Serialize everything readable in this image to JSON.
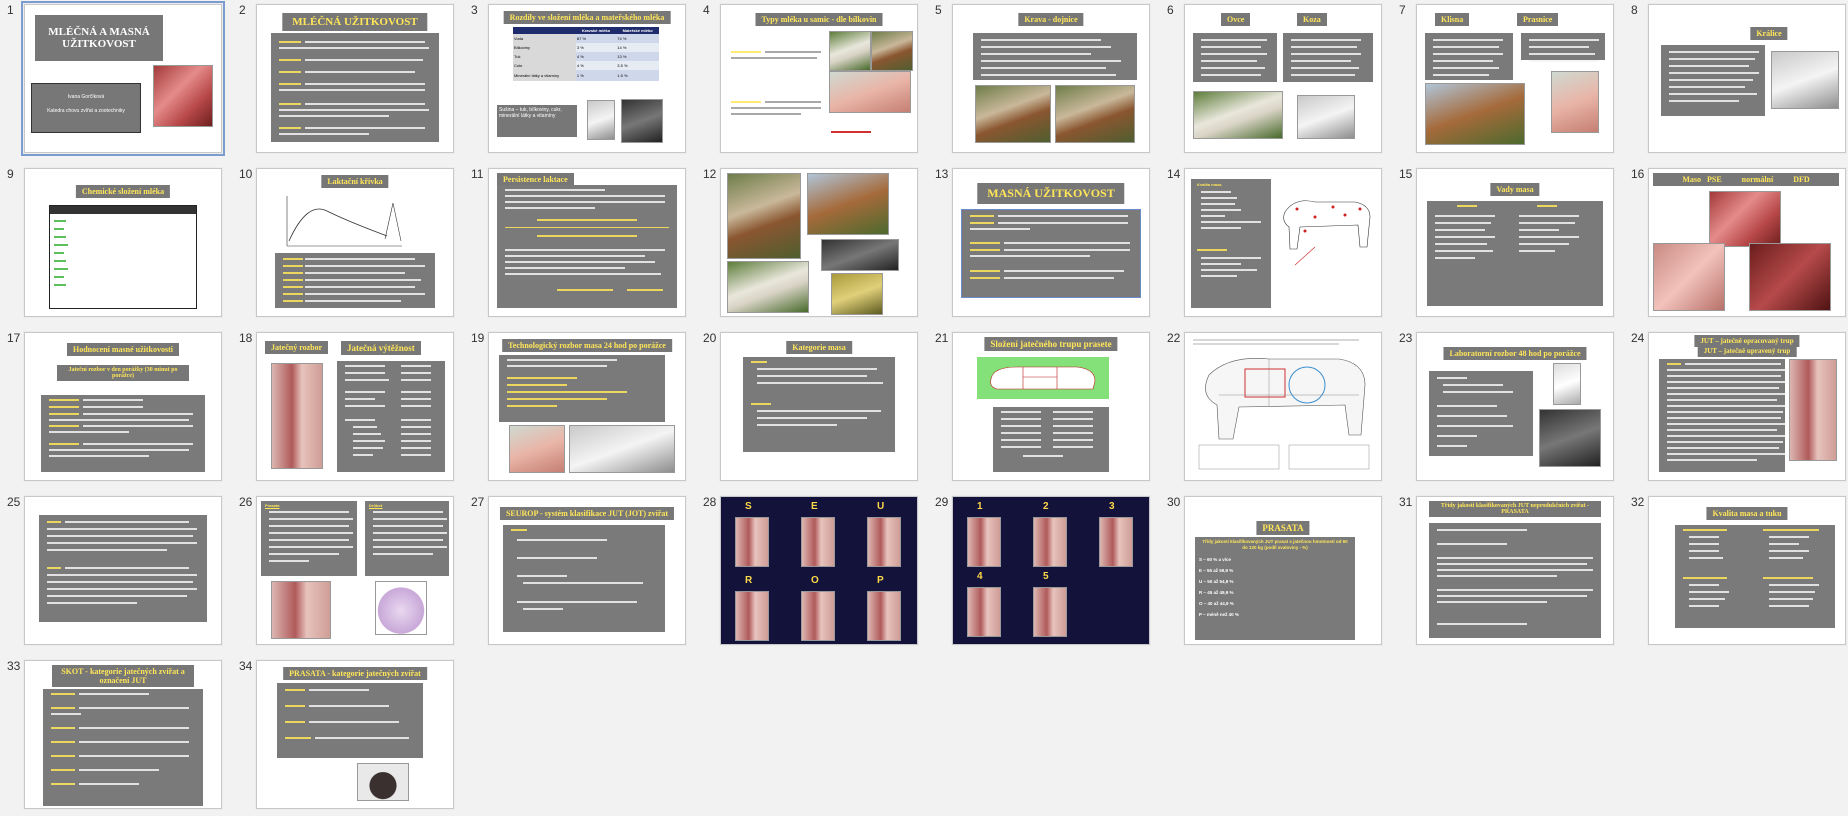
{
  "slides": [
    {
      "n": "1",
      "title": "MLÉČNÁ A MASNÁ UŽITKOVOST",
      "author": "Ivana Gorčíková",
      "dept": "Katedra chovu zvířat a zootechniky"
    },
    {
      "n": "2",
      "title": "MLÉČNÁ UŽITKOVOST"
    },
    {
      "n": "3",
      "title": "Rozdíly ve složení mléka a mateřského mléka",
      "table_header": [
        "",
        "Kravské mléko",
        "Mateřské mléko"
      ],
      "table_rows": [
        [
          "Voda",
          "87 %",
          "74 %"
        ],
        [
          "Bílkoviny",
          "3 %",
          "14 %"
        ],
        [
          "Tuk",
          "4 %",
          "13 %"
        ],
        [
          "Cukr",
          "4 %",
          "3.5 %"
        ],
        [
          "Minerální látky a vitamíny",
          "1 %",
          "1.5 %"
        ]
      ],
      "note": "Sušina – tuk, bílkoviny, cukr, minerální látky a vitamíny"
    },
    {
      "n": "4",
      "title": "Typy mléka u samic - dle bílkovin"
    },
    {
      "n": "5",
      "title": "Krava - dojnice"
    },
    {
      "n": "6",
      "title": "Ovce",
      "title2": "Koza"
    },
    {
      "n": "7",
      "title": "Klisna",
      "title2": "Prasnice"
    },
    {
      "n": "8",
      "title": "Králice"
    },
    {
      "n": "9",
      "title": "Chemické složení mléka"
    },
    {
      "n": "10",
      "title": "Laktační křivka"
    },
    {
      "n": "11",
      "title": "Persistence laktace"
    },
    {
      "n": "12",
      "title": ""
    },
    {
      "n": "13",
      "title": "MASNÁ UŽITKOVOST"
    },
    {
      "n": "14",
      "title": "Kvalita masa"
    },
    {
      "n": "15",
      "title": "Vady masa"
    },
    {
      "n": "16",
      "title": "Maso   PSE          normální          DFD"
    },
    {
      "n": "17",
      "title": "Hodnocení masné užitkovosti",
      "subtitle": "Jateční rozbor v den porážky (30 minut po porážce)"
    },
    {
      "n": "18",
      "title": "Jatečný rozbor",
      "title2": "Jatečná výtěžnost"
    },
    {
      "n": "19",
      "title": "Technologický rozbor masa 24 hod po porážce"
    },
    {
      "n": "20",
      "title": "Kategorie masa"
    },
    {
      "n": "21",
      "title": "Složení jatečného trupu prasete"
    },
    {
      "n": "22",
      "title": ""
    },
    {
      "n": "23",
      "title": "Laboratorní rozbor 48 hod po porážce"
    },
    {
      "n": "24",
      "title": "JUT – jatečně opracovaný trup",
      "title2": "JUT – jatečně upravený trup"
    },
    {
      "n": "25",
      "title": ""
    },
    {
      "n": "26",
      "title": "Prasata",
      "title2": "Drůbež"
    },
    {
      "n": "27",
      "title": "SEUROP - systém klasifikace JUT (JOT) zvířat"
    },
    {
      "n": "28",
      "title": "",
      "letters": [
        "S",
        "E",
        "U",
        "R",
        "O",
        "P"
      ]
    },
    {
      "n": "29",
      "title": "",
      "letters": [
        "1",
        "2",
        "3",
        "4",
        "5"
      ]
    },
    {
      "n": "30",
      "title": "PRASATA",
      "subtitle": "Třídy jakosti klasifikovaných JUT prasat s jatečnou hmotností od 60 do 120 kg (podíl svaloviny - %)",
      "items": [
        "S – 60 % a více",
        "E – 55 až 59,9 %",
        "U – 50 až 54,9 %",
        "R – 45 až 49,9 %",
        "O – 40 až 44,9 %",
        "P – méně než 40 %"
      ]
    },
    {
      "n": "31",
      "title": "Třídy jakosti klasifikovaných JUT neprodukčních zvířat - PRASATA"
    },
    {
      "n": "32",
      "title": "Kvalita masa a tuku"
    },
    {
      "n": "33",
      "title": "SKOT - kategorie jatečných zvířat a označení JUT"
    },
    {
      "n": "34",
      "title": "PRASATA - kategorie jatečných zvířat"
    }
  ]
}
